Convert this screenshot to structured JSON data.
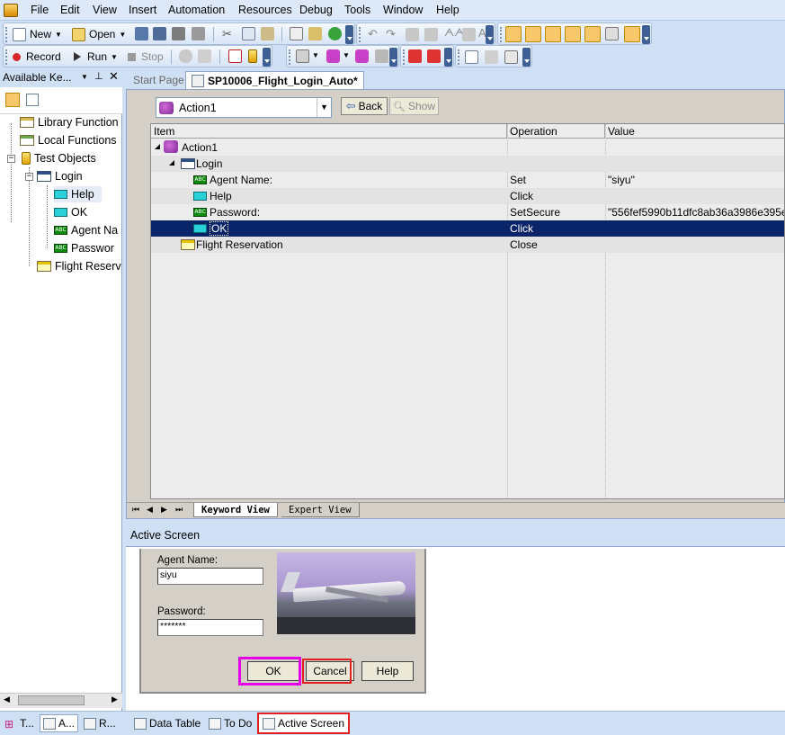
{
  "menu": [
    "File",
    "Edit",
    "View",
    "Insert",
    "Automation",
    "Resources",
    "Debug",
    "Tools",
    "Window",
    "Help"
  ],
  "toolbar": {
    "new_label": "New",
    "open_label": "Open",
    "record_label": "Record",
    "run_label": "Run",
    "stop_label": "Stop"
  },
  "left_panel": {
    "title": "Available Ke...",
    "tree": {
      "library_functions": "Library Function",
      "local_functions": "Local Functions",
      "test_objects": "Test Objects",
      "login": "Login",
      "help": "Help",
      "ok": "OK",
      "agent_name": "Agent Na",
      "password": "Passwor",
      "flight_reservation": "Flight Reserv"
    }
  },
  "doc_tabs": [
    "Start Page",
    "SP10006_Flight_Login_Auto*"
  ],
  "action_selector": {
    "value": "Action1"
  },
  "nav_buttons": {
    "back": "Back",
    "show": "Show"
  },
  "grid": {
    "columns": [
      "Item",
      "Operation",
      "Value"
    ],
    "rows": [
      {
        "item": "Action1",
        "operation": "",
        "value": ""
      },
      {
        "item": "Login",
        "operation": "",
        "value": ""
      },
      {
        "item": "Agent Name:",
        "operation": "Set",
        "value": "\"siyu\""
      },
      {
        "item": "Help",
        "operation": "Click",
        "value": ""
      },
      {
        "item": "Password:",
        "operation": "SetSecure",
        "value": "\"556fef5990b11dfc8ab36a3986e395e..."
      },
      {
        "item": "OK",
        "operation": "Click",
        "value": ""
      },
      {
        "item": "Flight Reservation",
        "operation": "Close",
        "value": ""
      }
    ]
  },
  "view_tabs": [
    "Keyword View",
    "Expert View"
  ],
  "active_screen": {
    "title": "Active Screen",
    "agent_name_label": "Agent Name:",
    "agent_name_value": "siyu",
    "password_label": "Password:",
    "password_value": "*******",
    "ok_button": "OK",
    "cancel_button": "Cancel",
    "help_button": "Help"
  },
  "bottom_tabs": [
    "T...",
    "A...",
    "R...",
    "Data Table",
    "To Do",
    "Active Screen"
  ],
  "colors": {
    "highlight_magenta": "#e600e6",
    "highlight_red": "#e02020",
    "selection": "#0a246a"
  }
}
